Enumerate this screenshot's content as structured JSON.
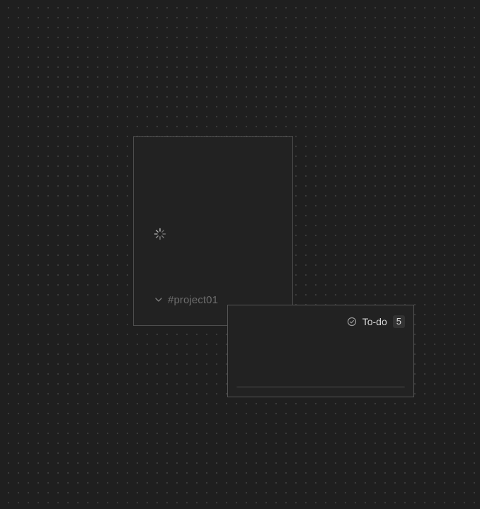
{
  "project_card": {
    "channel_label": "#project01",
    "loading_icon": "spinner-icon",
    "collapse_icon": "chevron-down-icon"
  },
  "todo_card": {
    "status_icon": "check-circle-icon",
    "label": "To-do",
    "count": "5",
    "progress": 0
  },
  "colors": {
    "background": "#1f1f1f",
    "card": "#222222",
    "card_border": "#4d4d4d",
    "muted_text": "#6d6d6d",
    "text": "#d8d8d8"
  }
}
